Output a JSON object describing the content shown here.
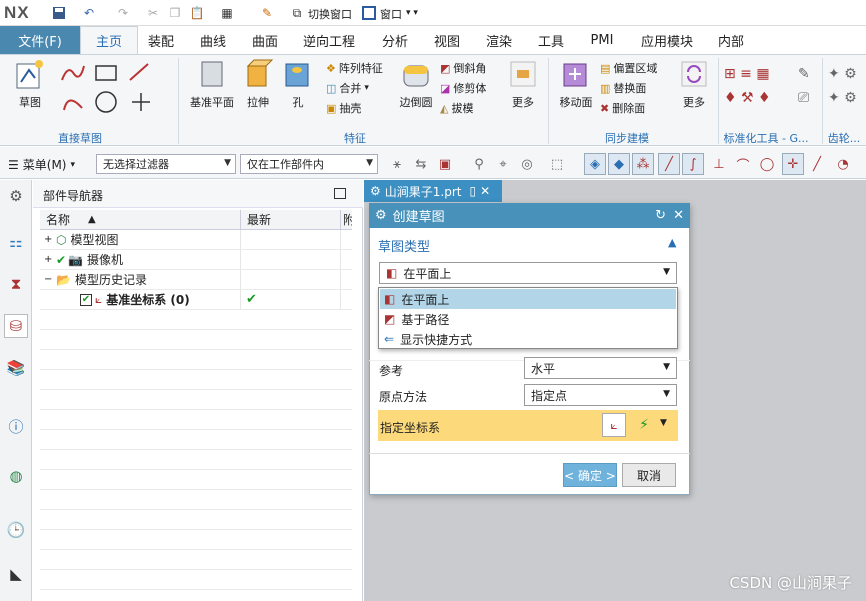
{
  "titlebar": {
    "logo": "NX",
    "switch_window": "切换窗口",
    "window_menu": "窗口"
  },
  "menu": {
    "file": "文件(F)",
    "tabs": [
      "主页",
      "装配",
      "曲线",
      "曲面",
      "逆向工程",
      "分析",
      "视图",
      "渲染",
      "工具",
      "PMI",
      "应用模块",
      "内部"
    ],
    "active": "主页"
  },
  "ribbon": {
    "sketch": "草图",
    "group_direct_sketch": "直接草图",
    "datum_plane": "基准平面",
    "extrude": "拉伸",
    "hole": "孔",
    "pattern_feature": "阵列特征",
    "unite": "合并",
    "shell": "抽壳",
    "edge_blend": "边倒圆",
    "chamfer": "倒斜角",
    "trim_body": "修剪体",
    "draft": "拔模",
    "more1": "更多",
    "group_feature": "特征",
    "move_face": "移动面",
    "offset_region": "偏置区域",
    "replace_face": "替换面",
    "delete_face": "删除面",
    "more2": "更多",
    "group_sync": "同步建模",
    "group_std": "标准化工具 - G...",
    "group_gear": "齿轮..."
  },
  "toolbar2": {
    "menu": "菜单(M)",
    "filter": "无选择过滤器",
    "scope": "仅在工作部件内"
  },
  "navigator": {
    "title": "部件导航器",
    "col_name": "名称",
    "col_latest": "最新",
    "col_extra": "附",
    "rows": [
      "模型视图",
      "摄像机",
      "模型历史记录",
      "基准坐标系 (0)"
    ],
    "check": "✔"
  },
  "doc_tab": {
    "name": "山涧果子1.prt"
  },
  "dialog": {
    "title": "创建草图",
    "section": "草图类型",
    "type_value": "在平面上",
    "options": [
      "在平面上",
      "基于路径",
      "显示快捷方式"
    ],
    "reference_label": "参考",
    "reference_value": "水平",
    "origin_label": "原点方法",
    "origin_value": "指定点",
    "csys_label": "指定坐标系",
    "ok": "< 确定 >",
    "cancel": "取消"
  },
  "watermark": "CSDN @山涧果子",
  "colors": {
    "accent": "#4a88b0",
    "dialog_header": "#4791bb",
    "highlight": "#fcd97a",
    "selected": "#b2d6e8"
  }
}
